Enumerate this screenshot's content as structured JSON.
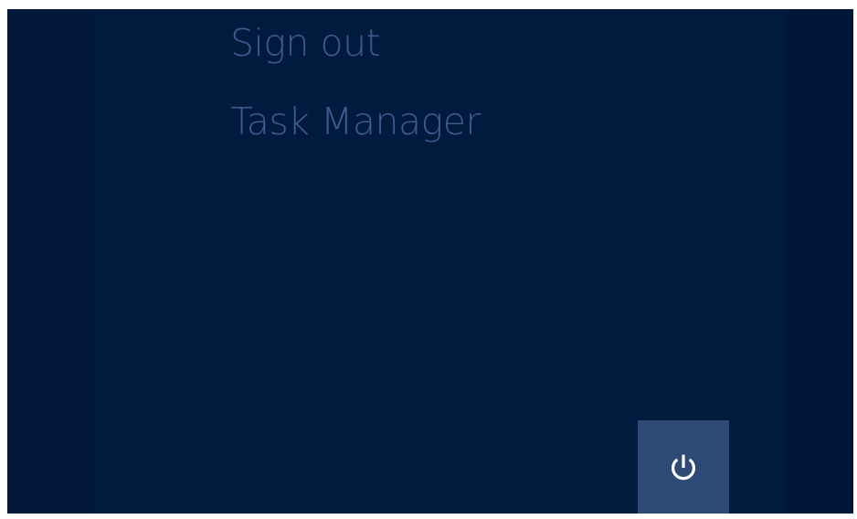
{
  "menu": {
    "items": [
      {
        "label": "Sign out"
      },
      {
        "label": "Task Manager"
      }
    ]
  },
  "power": {
    "icon": "power-icon"
  },
  "colors": {
    "background": "#021a3d",
    "menu_text": "#3c5c8f",
    "power_button_bg": "#2d4a74",
    "power_icon": "#ffffff"
  }
}
